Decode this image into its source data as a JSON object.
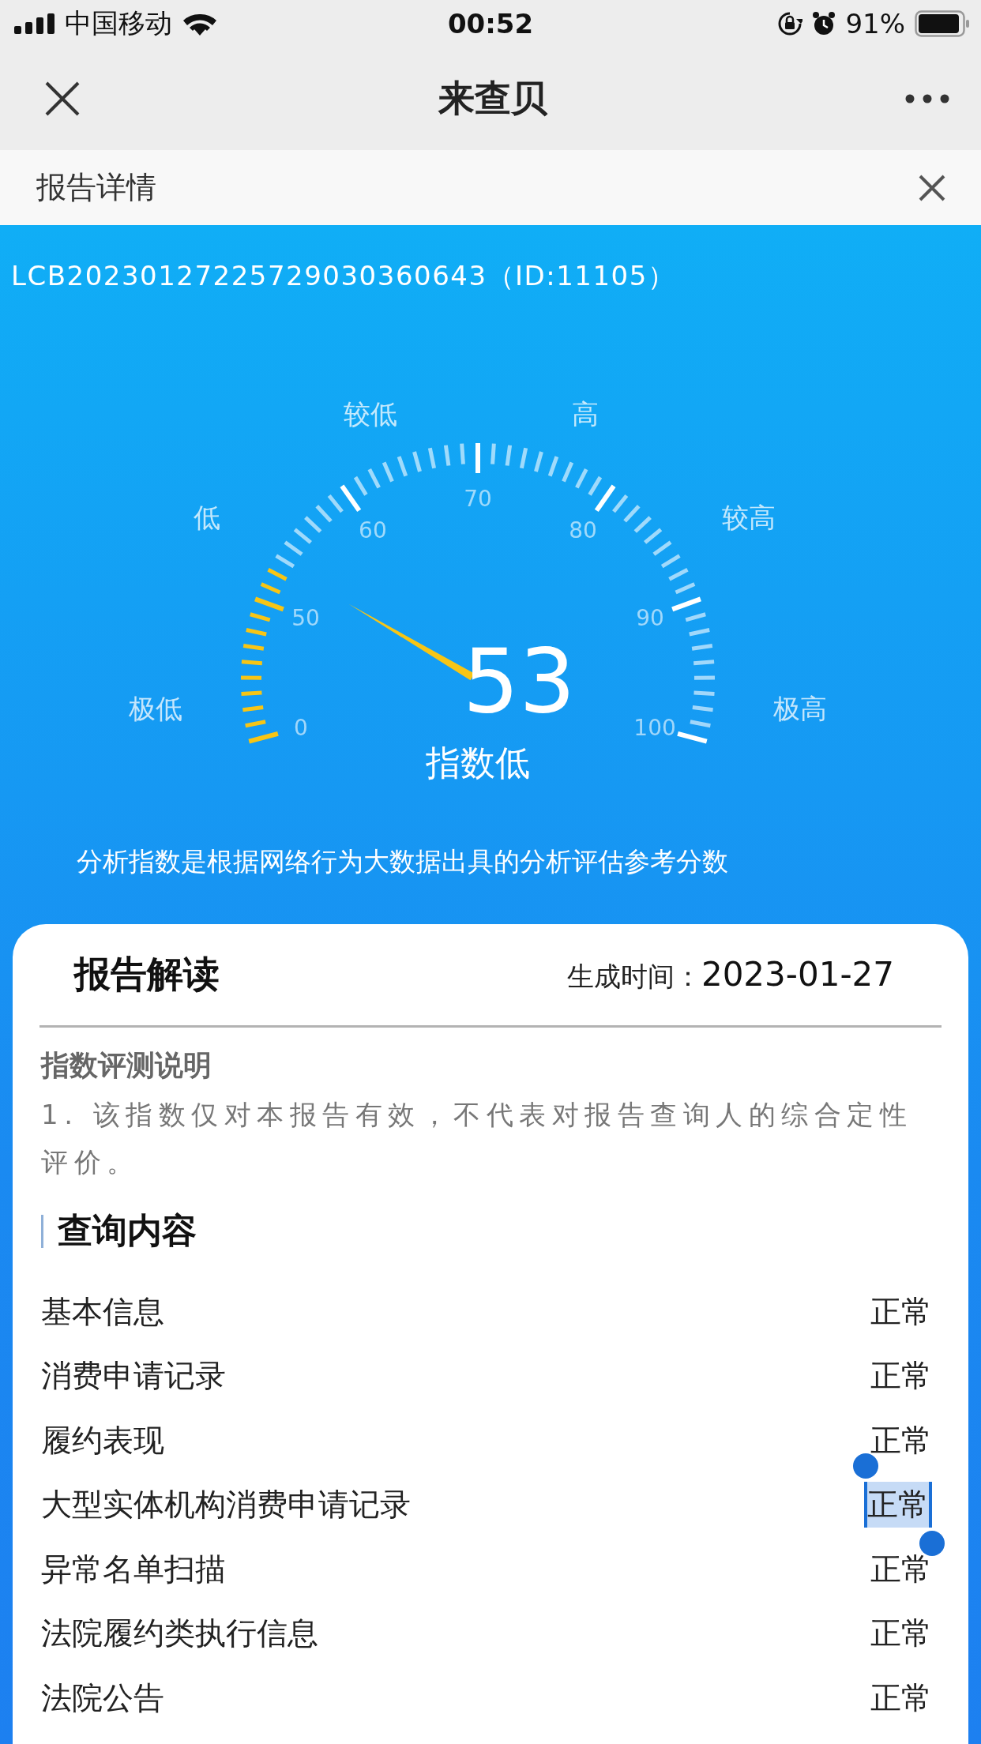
{
  "status_bar": {
    "carrier": "中国移动",
    "time": "00:52",
    "battery": "91%"
  },
  "nav": {
    "title": "来查贝"
  },
  "banner": {
    "title": "报告详情"
  },
  "report": {
    "id": "LCB20230127225729030360643（ID:11105）",
    "gauge": {
      "score": "53",
      "verdict": "指数低",
      "scale_labels": [
        "0",
        "50",
        "60",
        "70",
        "80",
        "90",
        "100"
      ],
      "band_labels": [
        "极低",
        "低",
        "较低",
        "高",
        "较高",
        "极高"
      ]
    },
    "note": "分析指数是根据网络行为大数据出具的分析评估参考分数"
  },
  "card": {
    "title": "报告解读",
    "generated_label": "生成时间：",
    "generated_date": "2023-01-27",
    "section_title": "指数评测说明",
    "section_text": "1. 该指数仅对本报告有效，不代表对报告查询人的综合定性评价。",
    "query_title": "查询内容",
    "rows": [
      {
        "label": "基本信息",
        "value": "正常",
        "selected": false
      },
      {
        "label": "消费申请记录",
        "value": "正常",
        "selected": false
      },
      {
        "label": "履约表现",
        "value": "正常",
        "selected": false
      },
      {
        "label": "大型实体机构消费申请记录",
        "value": "正常",
        "selected": true
      },
      {
        "label": "异常名单扫描",
        "value": "正常",
        "selected": false
      },
      {
        "label": "法院履约类执行信息",
        "value": "正常",
        "selected": false
      },
      {
        "label": "法院公告",
        "value": "正常",
        "selected": false
      }
    ]
  }
}
